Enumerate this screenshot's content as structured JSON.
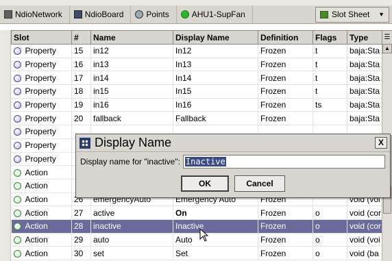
{
  "breadcrumb": [
    {
      "label": "NdioNetwork",
      "icon": "network-icon"
    },
    {
      "label": "NdioBoard",
      "icon": "board-icon"
    },
    {
      "label": "Points",
      "icon": "points-icon"
    },
    {
      "label": "AHU1-SupFan",
      "icon": "status-ok-icon"
    }
  ],
  "view_selector": {
    "label": "Slot Sheet",
    "icon": "grid-icon"
  },
  "table": {
    "columns": [
      "Slot",
      "#",
      "Name",
      "Display Name",
      "Definition",
      "Flags",
      "Type"
    ],
    "rows": [
      {
        "slot": "Property",
        "num": "15",
        "name": "in12",
        "display": "In12",
        "def": "Frozen",
        "flags": "t",
        "type": "baja:Sta"
      },
      {
        "slot": "Property",
        "num": "16",
        "name": "in13",
        "display": "In13",
        "def": "Frozen",
        "flags": "t",
        "type": "baja:Sta"
      },
      {
        "slot": "Property",
        "num": "17",
        "name": "in14",
        "display": "In14",
        "def": "Frozen",
        "flags": "t",
        "type": "baja:Sta"
      },
      {
        "slot": "Property",
        "num": "18",
        "name": "in15",
        "display": "In15",
        "def": "Frozen",
        "flags": "t",
        "type": "baja:Sta"
      },
      {
        "slot": "Property",
        "num": "19",
        "name": "in16",
        "display": "In16",
        "def": "Frozen",
        "flags": "ts",
        "type": "baja:Sta"
      },
      {
        "slot": "Property",
        "num": "20",
        "name": "fallback",
        "display": "Fallback",
        "def": "Frozen",
        "flags": "",
        "type": "baja:Sta"
      },
      {
        "slot": "Property",
        "num": "",
        "name": "",
        "display": "",
        "def": "",
        "flags": "",
        "type": ""
      },
      {
        "slot": "Property",
        "num": "",
        "name": "",
        "display": "",
        "def": "",
        "flags": "",
        "type": ""
      },
      {
        "slot": "Property",
        "num": "",
        "name": "",
        "display": "",
        "def": "",
        "flags": "",
        "type": ""
      },
      {
        "slot": "Action",
        "num": "",
        "name": "",
        "display": "",
        "def": "",
        "flags": "",
        "type": ""
      },
      {
        "slot": "Action",
        "num": "",
        "name": "",
        "display": "",
        "def": "",
        "flags": "",
        "type": ""
      },
      {
        "slot": "Action",
        "num": "26",
        "name": "emergencyAuto",
        "display": "Emergency Auto",
        "def": "Frozen",
        "flags": "",
        "type": "void (voi"
      },
      {
        "slot": "Action",
        "num": "27",
        "name": "active",
        "display": "On",
        "def": "Frozen",
        "flags": "o",
        "type": "void (cor"
      },
      {
        "slot": "Action",
        "num": "28",
        "name": "inactive",
        "display": "Inactive",
        "def": "Frozen",
        "flags": "o",
        "type": "void (cor"
      },
      {
        "slot": "Action",
        "num": "29",
        "name": "auto",
        "display": "Auto",
        "def": "Frozen",
        "flags": "o",
        "type": "void (voi"
      },
      {
        "slot": "Action",
        "num": "30",
        "name": "set",
        "display": "Set",
        "def": "Frozen",
        "flags": "o",
        "type": "void (ba"
      }
    ]
  },
  "dialog": {
    "title": "Display Name",
    "close_label": "X",
    "field_label": "Display name for \"inactive\":",
    "field_value": "Inactive",
    "ok_label": "OK",
    "cancel_label": "Cancel"
  }
}
